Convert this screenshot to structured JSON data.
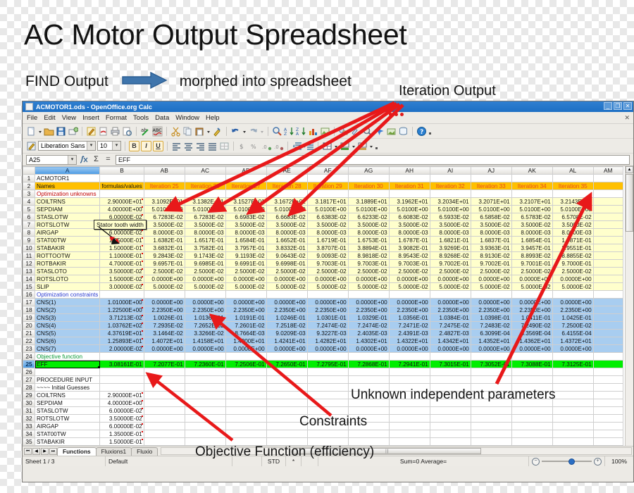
{
  "headline": {
    "title": "AC Motor Output Spreadsheet",
    "find_output": "FIND Output",
    "arrow_icon": "right-arrow-icon",
    "morphed": "morphed into spreadsheet",
    "iteration_output": "Iteration Output"
  },
  "window": {
    "title": "ACMOTOR1.ods - OpenOffice.org Calc",
    "buttons": {
      "minimize": "_",
      "restore": "❐",
      "close": "✕"
    },
    "menus": [
      "File",
      "Edit",
      "View",
      "Insert",
      "Format",
      "Tools",
      "Data",
      "Window",
      "Help"
    ],
    "menu_close": "✕"
  },
  "toolbar": {
    "font_name": "Liberation Sans",
    "font_size": "10",
    "bold": "B",
    "italic": "I",
    "underline": "U",
    "combo_arrow": "▾"
  },
  "formula_bar": {
    "name_box": "A25",
    "function_wizard_icon": "function-wizard-icon",
    "sum_icon": "Σ",
    "equals_icon": "=",
    "input_line": "EFF"
  },
  "grid": {
    "columns": [
      "A",
      "B",
      "AB",
      "AC",
      "AD",
      "AE",
      "AF",
      "AG",
      "AH",
      "AI",
      "AJ",
      "AK",
      "AL",
      "AM"
    ],
    "selected_column": "A",
    "selected_row": "25",
    "rows": [
      {
        "n": "1",
        "style": "plain",
        "cells": [
          "ACMOTOR1",
          "",
          "",
          "",
          "",
          "",
          "",
          "",
          "",
          "",
          "",
          "",
          "",
          ""
        ]
      },
      {
        "n": "2",
        "style": "header",
        "cells": [
          "Names",
          "formulas/values",
          "Iteration 25",
          "Iteration 26",
          "Iteration 27",
          "Iteration 28",
          "Iteration 29",
          "Iteration 30",
          "Iteration 31",
          "Iteration 32",
          "Iteration 33",
          "Iteration 34",
          "Iteration 35",
          ""
        ]
      },
      {
        "n": "3",
        "style": "sect-red",
        "cells": [
          "Optimization unknowns",
          "",
          "",
          "",
          "",
          "",
          "",
          "",
          "",
          "",
          "",
          "",
          "",
          ""
        ]
      },
      {
        "n": "4",
        "style": "unknown",
        "cells": [
          "COILTRNS",
          "2.90000E+01",
          "3.1092E+01",
          "3.1382E+01",
          "3.1527E+01",
          "3.1672E+01",
          "3.1817E+01",
          "3.1889E+01",
          "3.1962E+01",
          "3.2034E+01",
          "3.2071E+01",
          "3.2107E+01",
          "3.2143E+01",
          ""
        ]
      },
      {
        "n": "5",
        "style": "unknown",
        "cells": [
          "SEPDIAM",
          "4.00000E+00",
          "5.0100E+00",
          "5.0100E+00",
          "5.0100E+00",
          "5.0100E+00",
          "5.0100E+00",
          "5.0100E+00",
          "5.0100E+00",
          "5.0100E+00",
          "5.0100E+00",
          "5.0100E+00",
          "5.0100E+00",
          ""
        ]
      },
      {
        "n": "6",
        "style": "unknown",
        "cells": [
          "STASLOTW",
          "6.00000E-02",
          "6.7283E-02",
          "6.7283E-02",
          "6.6983E-02",
          "6.6683E-02",
          "6.6383E-02",
          "6.6233E-02",
          "6.6083E-02",
          "6.5933E-02",
          "6.5858E-02",
          "6.5783E-02",
          "6.5708E-02",
          ""
        ]
      },
      {
        "n": "7",
        "style": "unknown",
        "cells": [
          "ROTSLOTW",
          "3.50000E-02",
          "3.5000E-02",
          "3.5000E-02",
          "3.5000E-02",
          "3.5000E-02",
          "3.5000E-02",
          "3.5000E-02",
          "3.5000E-02",
          "3.5000E-02",
          "3.5000E-02",
          "3.5000E-02",
          "3.5000E-02",
          ""
        ]
      },
      {
        "n": "8",
        "style": "unknown",
        "cells": [
          "AIRGAP",
          "6.00000E-02",
          "8.0000E-03",
          "8.0000E-03",
          "8.0000E-03",
          "8.0000E-03",
          "8.0000E-03",
          "8.0000E-03",
          "8.0000E-03",
          "8.0000E-03",
          "8.0000E-03",
          "8.0000E-03",
          "8.0000E-03",
          ""
        ]
      },
      {
        "n": "9",
        "style": "unknown",
        "cells": [
          "STAT00TW",
          "1.35000E-01",
          "1.6382E-01",
          "1.6517E-01",
          "1.6584E-01",
          "1.6652E-01",
          "1.6719E-01",
          "1.6753E-01",
          "1.6787E-01",
          "1.6821E-01",
          "1.6837E-01",
          "1.6854E-01",
          "1.6871E-01",
          ""
        ]
      },
      {
        "n": "10",
        "style": "unknown",
        "cells": [
          "STABAKIR",
          "1.50000E-01",
          "3.6832E-01",
          "3.7582E-01",
          "3.7957E-01",
          "3.8332E-01",
          "3.8707E-01",
          "3.8894E-01",
          "3.9082E-01",
          "3.9269E-01",
          "3.9363E-01",
          "3.9457E-01",
          "3.9551E-01",
          ""
        ]
      },
      {
        "n": "11",
        "style": "unknown",
        "cells": [
          "ROTTOOTW",
          "1.10000E-01",
          "9.2843E-02",
          "9.1743E-02",
          "9.1193E-02",
          "9.0643E-02",
          "9.0093E-02",
          "8.9818E-02",
          "8.9543E-02",
          "8.9268E-02",
          "8.9130E-02",
          "8.8993E-02",
          "8.8855E-02",
          ""
        ]
      },
      {
        "n": "12",
        "style": "unknown",
        "cells": [
          "ROTBAKIR",
          "4.70000E-01",
          "9.6957E-01",
          "9.6985E-01",
          "9.6991E-01",
          "9.6998E-01",
          "9.7003E-01",
          "9.7003E-01",
          "9.7003E-01",
          "9.7002E-01",
          "9.7002E-01",
          "9.7001E-01",
          "9.7000E-01",
          ""
        ]
      },
      {
        "n": "13",
        "style": "unknown",
        "cells": [
          "STASLOTO",
          "3.50000E-02",
          "2.5000E-02",
          "2.5000E-02",
          "2.5000E-02",
          "2.5000E-02",
          "2.5000E-02",
          "2.5000E-02",
          "2.5000E-02",
          "2.5000E-02",
          "2.5000E-02",
          "2.5000E-02",
          "2.5000E-02",
          ""
        ]
      },
      {
        "n": "14",
        "style": "unknown",
        "cells": [
          "ROTSLOTO",
          "1.50000E-02",
          "0.0000E+00",
          "0.0000E+00",
          "0.0000E+00",
          "0.0000E+00",
          "0.0000E+00",
          "0.0000E+00",
          "0.0000E+00",
          "0.0000E+00",
          "0.0000E+00",
          "0.0000E+00",
          "0.0000E+00",
          ""
        ]
      },
      {
        "n": "15",
        "style": "unknown",
        "cells": [
          "SLIP",
          "3.00000E-02",
          "5.0000E-02",
          "5.0000E-02",
          "5.0000E-02",
          "5.0000E-02",
          "5.0000E-02",
          "5.0000E-02",
          "5.0000E-02",
          "5.0000E-02",
          "5.0000E-02",
          "5.0000E-02",
          "5.0000E-02",
          ""
        ]
      },
      {
        "n": "16",
        "style": "sect-blue",
        "cells": [
          "Optimization constraints",
          "",
          "",
          "",
          "",
          "",
          "",
          "",
          "",
          "",
          "",
          "",
          "",
          ""
        ]
      },
      {
        "n": "17",
        "style": "constraint",
        "cells": [
          "CNS(1)",
          "1.01000E+00",
          "0.0000E+00",
          "0.0000E+00",
          "0.0000E+00",
          "0.0000E+00",
          "0.0000E+00",
          "0.0000E+00",
          "0.0000E+00",
          "0.0000E+00",
          "0.0000E+00",
          "0.0000E+00",
          "0.0000E+00",
          ""
        ]
      },
      {
        "n": "18",
        "style": "constraint",
        "cells": [
          "CNS(2)",
          "1.22500E+00",
          "2.2350E+00",
          "2.2350E+00",
          "2.2350E+00",
          "2.2350E+00",
          "2.2350E+00",
          "2.2350E+00",
          "2.2350E+00",
          "2.2350E+00",
          "2.2350E+00",
          "2.2350E+00",
          "2.2350E+00",
          ""
        ]
      },
      {
        "n": "19",
        "style": "constraint",
        "cells": [
          "CNS(3)",
          "3.71213E-02",
          "1.0026E-01",
          "1.0136E-01",
          "1.0191E-01",
          "1.0246E-01",
          "1.0301E-01",
          "1.0329E-01",
          "1.0356E-01",
          "1.0384E-01",
          "1.0398E-01",
          "1.0411E-01",
          "1.0425E-01",
          ""
        ]
      },
      {
        "n": "20",
        "style": "constraint",
        "cells": [
          "CNS(4)",
          "1.03762E+02",
          "7.2935E-02",
          "7.2652E-02",
          "7.2601E-02",
          "7.2518E-02",
          "7.2474E-02",
          "7.2474E-02",
          "7.2471E-02",
          "7.2475E-02",
          "7.2483E-02",
          "7.2490E-02",
          "7.2500E-02",
          ""
        ]
      },
      {
        "n": "21",
        "style": "constraint",
        "cells": [
          "CNS(5)",
          "4.37619E+01",
          "3.1464E-02",
          "3.3266E-02",
          "8.7664E-03",
          "9.0209E-03",
          "9.3227E-03",
          "2.4035E-03",
          "2.4391E-03",
          "2.4827E-03",
          "6.3099E-04",
          "6.3569E-04",
          "6.4155E-04",
          ""
        ]
      },
      {
        "n": "22",
        "style": "constraint",
        "cells": [
          "CNS(6)",
          "1.25893E+01",
          "1.4072E+01",
          "1.4158E+01",
          "1.4200E+01",
          "1.4241E+01",
          "1.4282E+01",
          "1.4302E+01",
          "1.4322E+01",
          "1.4342E+01",
          "1.4352E+01",
          "1.4362E+01",
          "1.4372E+01",
          ""
        ]
      },
      {
        "n": "23",
        "style": "constraint",
        "cells": [
          "CNS(7)",
          "2.00000E-02",
          "0.0000E+00",
          "0.0000E+00",
          "0.0000E+00",
          "0.0000E+00",
          "0.0000E+00",
          "0.0000E+00",
          "0.0000E+00",
          "0.0000E+00",
          "0.0000E+00",
          "0.0000E+00",
          "0.0000E+00",
          ""
        ]
      },
      {
        "n": "24",
        "style": "sect-green",
        "cells": [
          "Objective function",
          "",
          "",
          "",
          "",
          "",
          "",
          "",
          "",
          "",
          "",
          "",
          "",
          ""
        ]
      },
      {
        "n": "25",
        "style": "objective",
        "cells": [
          "EFF",
          "3.08161E-01",
          "7.2077E-01",
          "7.2360E-01",
          "7.2506E-01",
          "7.2650E-01",
          "7.2795E-01",
          "7.2868E-01",
          "7.2941E-01",
          "7.3015E-01",
          "7.3052E-01",
          "7.3088E-01",
          "7.3125E-01",
          ""
        ]
      },
      {
        "n": "26",
        "style": "plain",
        "cells": [
          "",
          "",
          "",
          "",
          "",
          "",
          "",
          "",
          "",
          "",
          "",
          "",
          "",
          ""
        ]
      },
      {
        "n": "27",
        "style": "plain",
        "cells": [
          "PROCEDURE INPUT",
          "",
          "",
          "",
          "",
          "",
          "",
          "",
          "",
          "",
          "",
          "",
          "",
          ""
        ]
      },
      {
        "n": "28",
        "style": "plain",
        "cells": [
          "~~~~ Initial Guesses",
          "",
          "",
          "",
          "",
          "",
          "",
          "",
          "",
          "",
          "",
          "",
          "",
          ""
        ]
      },
      {
        "n": "29",
        "style": "input",
        "cells": [
          "COILTRNS",
          "2.90000E+01",
          "",
          "",
          "",
          "",
          "",
          "",
          "",
          "",
          "",
          "",
          "",
          ""
        ]
      },
      {
        "n": "30",
        "style": "input",
        "cells": [
          "SEPDIAM",
          "4.00000E+00",
          "",
          "",
          "",
          "",
          "",
          "",
          "",
          "",
          "",
          "",
          "",
          ""
        ]
      },
      {
        "n": "31",
        "style": "input",
        "cells": [
          "STASLOTW",
          "6.00000E-02",
          "",
          "",
          "",
          "",
          "",
          "",
          "",
          "",
          "",
          "",
          "",
          ""
        ]
      },
      {
        "n": "32",
        "style": "input",
        "cells": [
          "ROTSLOTW",
          "3.50000E-02",
          "",
          "",
          "",
          "",
          "",
          "",
          "",
          "",
          "",
          "",
          "",
          ""
        ]
      },
      {
        "n": "33",
        "style": "input",
        "cells": [
          "AIRGAP",
          "6.00000E-02",
          "",
          "",
          "",
          "",
          "",
          "",
          "",
          "",
          "",
          "",
          "",
          ""
        ]
      },
      {
        "n": "34",
        "style": "input",
        "cells": [
          "STAT00TW",
          "1.35000E-01",
          "",
          "",
          "",
          "",
          "",
          "",
          "",
          "",
          "",
          "",
          "",
          ""
        ]
      },
      {
        "n": "35",
        "style": "input",
        "cells": [
          "STABAKIR",
          "1.50000E-01",
          "",
          "",
          "",
          "",
          "",
          "",
          "",
          "",
          "",
          "",
          "",
          ""
        ]
      }
    ]
  },
  "tooltip": {
    "text": "Stator tooth width"
  },
  "sheet_bar": {
    "nav": [
      "⏮",
      "◀",
      "▶",
      "⏭"
    ],
    "tabs": [
      "Functions",
      "Fluxions1",
      "Fluxio"
    ],
    "active_tab": "Functions"
  },
  "status_bar": {
    "sheet": "Sheet 1 / 3",
    "page_style": "Default",
    "blank1": "",
    "mode": "STD",
    "selection": "*",
    "blank2": "",
    "sum": "Sum=0  Average=",
    "zoom_out": "−",
    "zoom_in": "+",
    "zoom": "100%"
  },
  "annotations": {
    "unknown_params": "Unknown independent parameters",
    "constraints": "Constraints",
    "objective_function": "Objective Function (efficiency)"
  },
  "colors": {
    "header_orange": "#ffc000",
    "iteration_text": "#e8491d",
    "unknown_yellow": "#ffffcc",
    "constraint_blue": "#a8cdf0",
    "objective_green": "#00ee00",
    "arrow_red": "#e8191a",
    "titlebar_blue": "#2f7fd0"
  }
}
